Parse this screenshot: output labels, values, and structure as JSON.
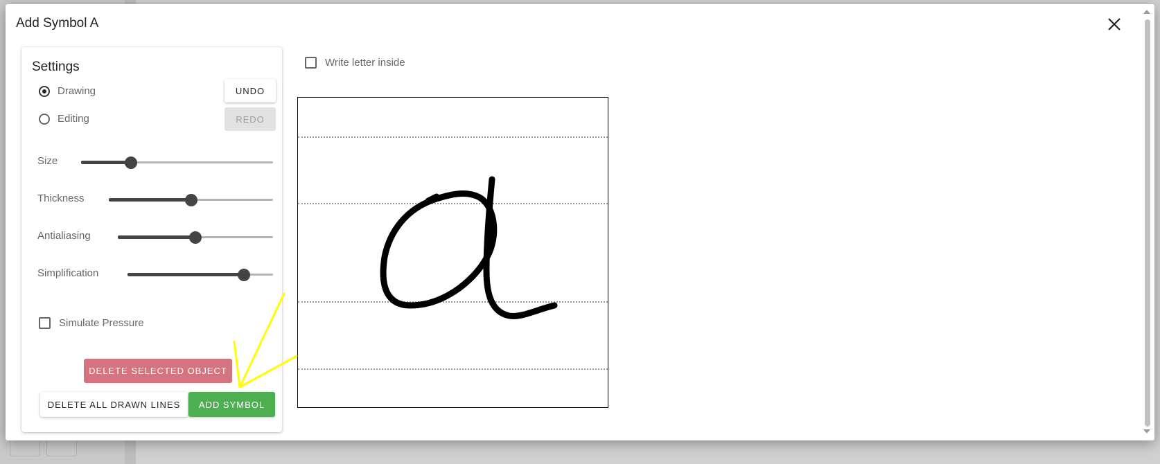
{
  "dialog": {
    "title": "Add Symbol A",
    "close_icon": "close-icon"
  },
  "settings": {
    "title": "Settings",
    "modes": [
      {
        "label": "Drawing",
        "checked": true
      },
      {
        "label": "Editing",
        "checked": false
      }
    ],
    "undo_label": "UNDO",
    "redo_label": "REDO",
    "sliders": [
      {
        "label": "Size",
        "value": 0.26
      },
      {
        "label": "Thickness",
        "value": 0.5
      },
      {
        "label": "Antialiasing",
        "value": 0.5
      },
      {
        "label": "Simplification",
        "value": 0.8
      }
    ],
    "simulate_pressure": {
      "label": "Simulate Pressure",
      "checked": false
    },
    "delete_selected_label": "DELETE SELECTED OBJECT",
    "delete_all_label": "DELETE ALL DRAWN LINES",
    "add_symbol_label": "ADD SYMBOL"
  },
  "canvas": {
    "write_letter_inside": {
      "label": "Write letter inside",
      "checked": false
    },
    "drawn_letter": "handwritten-a-stroke"
  },
  "colors": {
    "add_button": "#4caf50",
    "delete_selected_button": "#d4747e",
    "annotation": "#ffff00"
  }
}
